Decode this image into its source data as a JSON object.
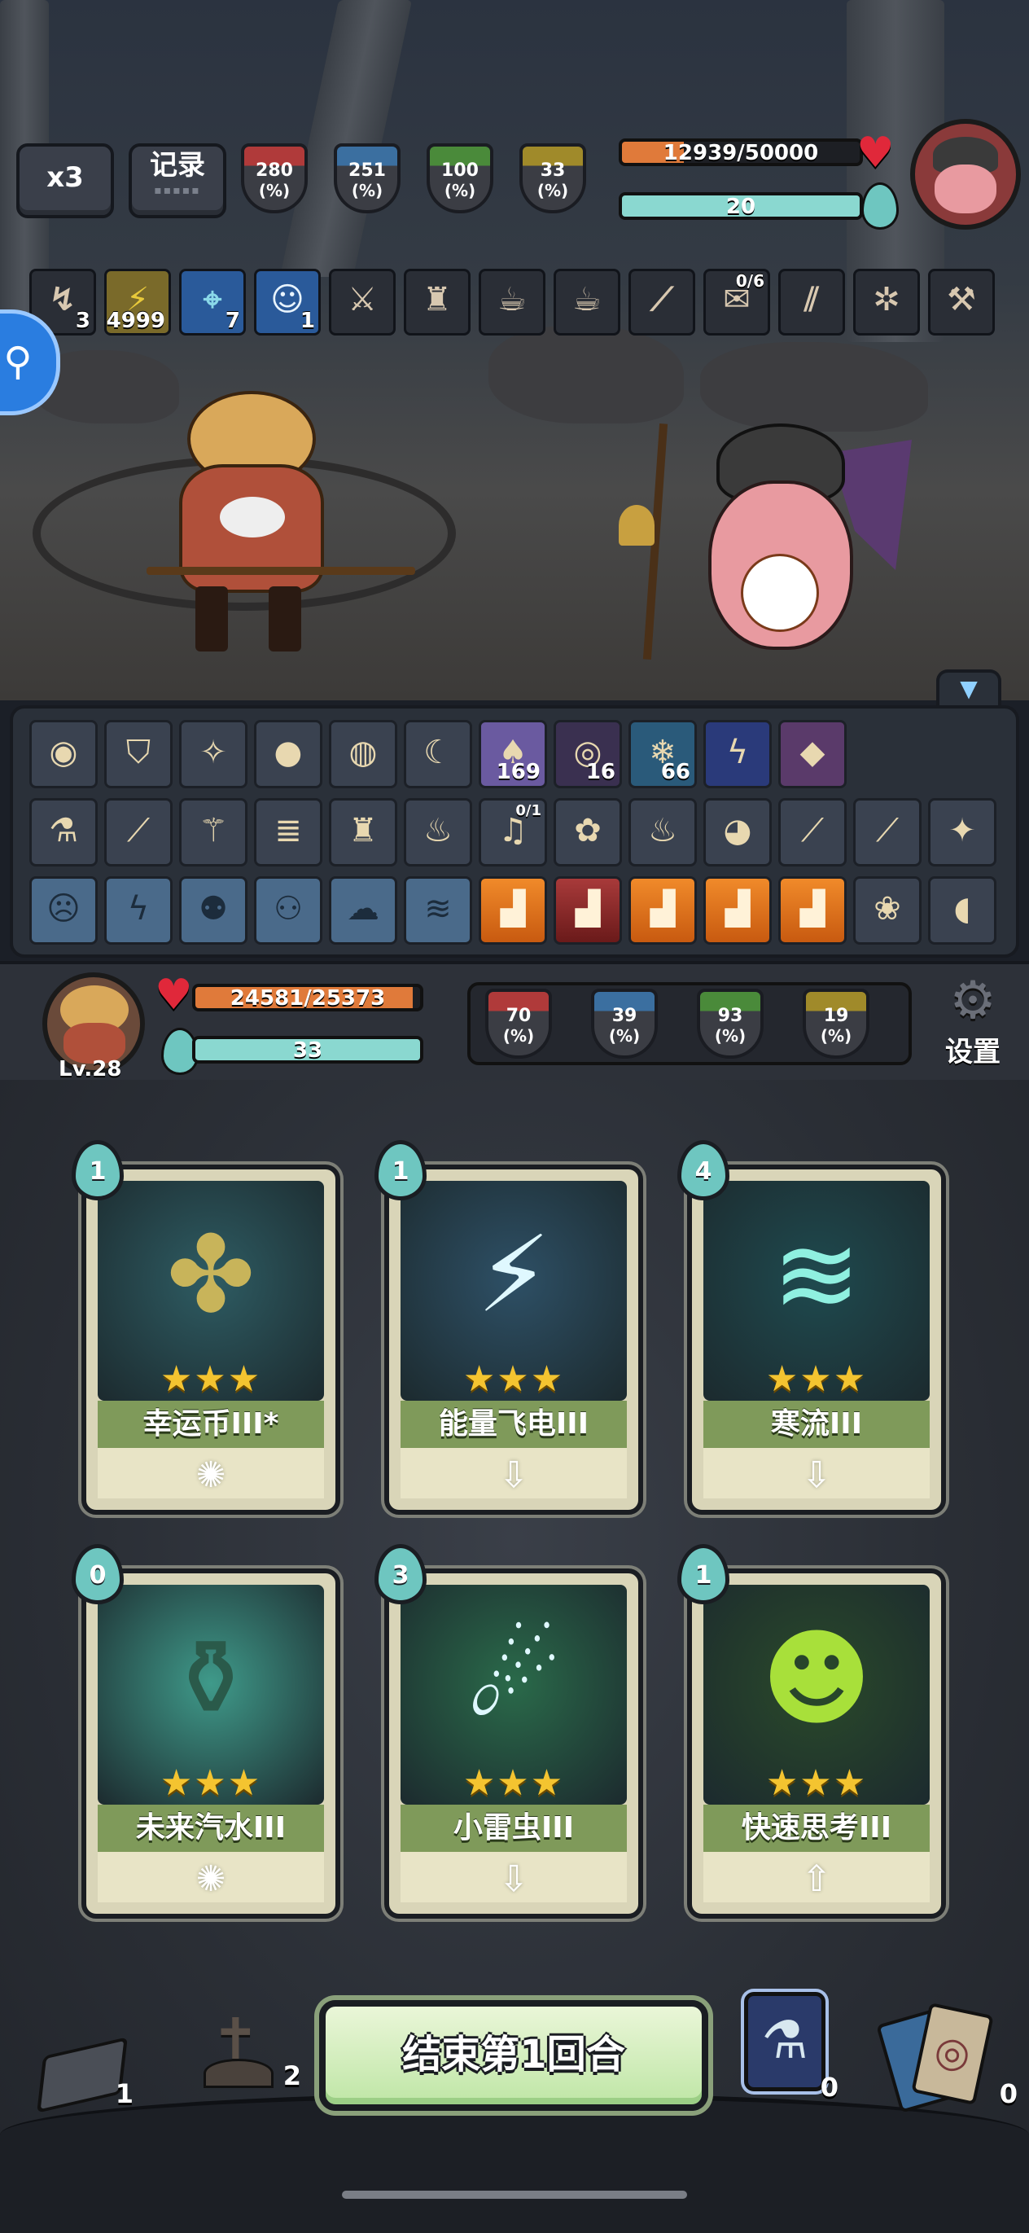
{
  "top": {
    "speed_label": "x3",
    "log_label": "记录",
    "enemy_stats": [
      {
        "value": "280",
        "unit": "(%)",
        "icon": "attack-icon",
        "color": "#b03a3a"
      },
      {
        "value": "251",
        "unit": "(%)",
        "icon": "question-icon",
        "color": "#3b6fa0"
      },
      {
        "value": "100",
        "unit": "(%)",
        "icon": "defense-icon",
        "color": "#4a8a3a"
      },
      {
        "value": "33",
        "unit": "(%)",
        "icon": "crit-icon",
        "color": "#a08a2a"
      }
    ],
    "enemy_hp": "12939/50000",
    "enemy_hp_fraction": 0.259,
    "enemy_energy": "20",
    "buffs": [
      {
        "icon": "lightning-down-icon",
        "count": "3"
      },
      {
        "icon": "lightning-icon",
        "count": "4999"
      },
      {
        "icon": "target-icon",
        "count": "7"
      },
      {
        "icon": "ghost-icon",
        "count": "1"
      },
      {
        "icon": "dagger-icon",
        "count": ""
      },
      {
        "icon": "red-doll-icon",
        "count": ""
      },
      {
        "icon": "teacup-icon",
        "count": ""
      },
      {
        "icon": "coffee-cup-icon",
        "count": ""
      },
      {
        "icon": "claw-icon",
        "count": ""
      },
      {
        "icon": "scroll-icon",
        "count": "0/6"
      },
      {
        "icon": "wood-icon",
        "count": ""
      },
      {
        "icon": "gear-orb-icon",
        "count": ""
      },
      {
        "icon": "knife-icon",
        "count": ""
      }
    ]
  },
  "items": {
    "row1": [
      {
        "icon": "crystal-ball-icon",
        "count": ""
      },
      {
        "icon": "shield-relic-icon",
        "count": ""
      },
      {
        "icon": "fish-icon",
        "count": ""
      },
      {
        "icon": "sack-icon",
        "count": ""
      },
      {
        "icon": "globe-icon",
        "count": ""
      },
      {
        "icon": "banana-icon",
        "count": ""
      },
      {
        "icon": "mushroom-icon",
        "count": "169"
      },
      {
        "icon": "vortex-icon",
        "count": "16"
      },
      {
        "icon": "snowflake-icon",
        "count": "66"
      },
      {
        "icon": "storm-icon",
        "count": ""
      },
      {
        "icon": "crystal-icon",
        "count": ""
      }
    ],
    "row2": [
      {
        "icon": "potion-icon",
        "count": ""
      },
      {
        "icon": "feather-icon",
        "count": ""
      },
      {
        "icon": "staff-icon",
        "count": ""
      },
      {
        "icon": "mummy-icon",
        "count": ""
      },
      {
        "icon": "red-figure-icon",
        "count": ""
      },
      {
        "icon": "pouch-icon",
        "count": ""
      },
      {
        "icon": "bell-icon",
        "frac": "0/1"
      },
      {
        "icon": "berry-icon",
        "count": ""
      },
      {
        "icon": "flame-bowl-icon",
        "count": ""
      },
      {
        "icon": "owl-icon",
        "count": ""
      },
      {
        "icon": "blue-blade-icon",
        "count": ""
      },
      {
        "icon": "golden-blade-icon",
        "count": ""
      },
      {
        "icon": "ice-cream-icon",
        "count": ""
      }
    ],
    "row3": [
      {
        "icon": "rune-face-icon",
        "kind": "rune"
      },
      {
        "icon": "rune-lightning-icon",
        "kind": "rune"
      },
      {
        "icon": "rune-monster-icon",
        "kind": "rune"
      },
      {
        "icon": "rune-beast-icon",
        "kind": "rune"
      },
      {
        "icon": "rune-cloud-icon",
        "kind": "rune"
      },
      {
        "icon": "rune-wind-icon",
        "kind": "rune"
      },
      {
        "icon": "boot-icon",
        "kind": "boot"
      },
      {
        "icon": "boot-red-icon",
        "kind": "boot-red"
      },
      {
        "icon": "boot-icon",
        "kind": "boot"
      },
      {
        "icon": "boot-icon",
        "kind": "boot"
      },
      {
        "icon": "boot-icon",
        "kind": "boot"
      },
      {
        "icon": "hamster-icon",
        "kind": "item"
      },
      {
        "icon": "meat-icon",
        "kind": "item"
      }
    ]
  },
  "player": {
    "level": "Lv.28",
    "hp": "24581/25373",
    "hp_fraction": 0.969,
    "energy": "33",
    "stats": [
      {
        "value": "70",
        "unit": "(%)",
        "icon": "attack-icon",
        "color": "#b03a3a"
      },
      {
        "value": "39",
        "unit": "(%)",
        "icon": "question-icon",
        "color": "#3b6fa0"
      },
      {
        "value": "93",
        "unit": "(%)",
        "icon": "defense-icon",
        "color": "#4a8a3a"
      },
      {
        "value": "19",
        "unit": "(%)",
        "icon": "crit-icon",
        "color": "#a08a2a"
      }
    ],
    "settings_label": "设置"
  },
  "cards": [
    {
      "cost": "1",
      "name": "幸运币III*",
      "stars": "★★★",
      "foot_icon": "sparkle-icon",
      "foot_glyph": "✺",
      "art": "lucky-coin-art",
      "art_bg": "#2e5c63"
    },
    {
      "cost": "1",
      "name": "能量飞电III",
      "stars": "★★★",
      "foot_icon": "arrow-down-icon",
      "foot_glyph": "⇩",
      "art": "lightning-bolt-art",
      "art_bg": "#2e5066"
    },
    {
      "cost": "4",
      "name": "寒流III",
      "stars": "★★★",
      "foot_icon": "arrow-down-icon",
      "foot_glyph": "⇩",
      "art": "cold-wave-art",
      "art_bg": "#1f4a4f"
    },
    {
      "cost": "0",
      "name": "未来汽水III",
      "stars": "★★★",
      "foot_icon": "sparkle-icon",
      "foot_glyph": "✺",
      "art": "soda-bottle-art",
      "art_bg": "#3f9a8a"
    },
    {
      "cost": "3",
      "name": "小雷虫III",
      "stars": "★★★",
      "foot_icon": "arrow-down-icon",
      "foot_glyph": "⇩",
      "art": "thunder-bug-art",
      "art_bg": "#2a6a4a"
    },
    {
      "cost": "1",
      "name": "快速思考III",
      "stars": "★★★",
      "foot_icon": "arrow-up-icon",
      "foot_glyph": "⇧",
      "art": "quick-think-art",
      "art_bg": "#2a4a2a"
    }
  ],
  "bottom": {
    "draw_pile_count": "1",
    "grave_count": "2",
    "end_turn_label": "结束第1回合",
    "potion_count": "0",
    "discard_count": "0"
  }
}
